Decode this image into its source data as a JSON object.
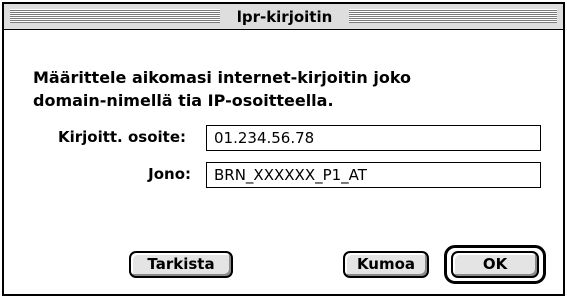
{
  "dialog": {
    "title": "lpr-kirjoitin",
    "message_line1": "Määrittele aikomasi internet-kirjoitin joko",
    "message_line2": "domain-nimellä tia IP-osoitteella."
  },
  "fields": {
    "address_label": "Kirjoitt. osoite:",
    "address_value": "01.234.56.78",
    "queue_label": "Jono:",
    "queue_value": "BRN_XXXXXX_P1_AT"
  },
  "buttons": {
    "check": "Tarkista",
    "cancel": "Kumoa",
    "ok": "OK"
  }
}
